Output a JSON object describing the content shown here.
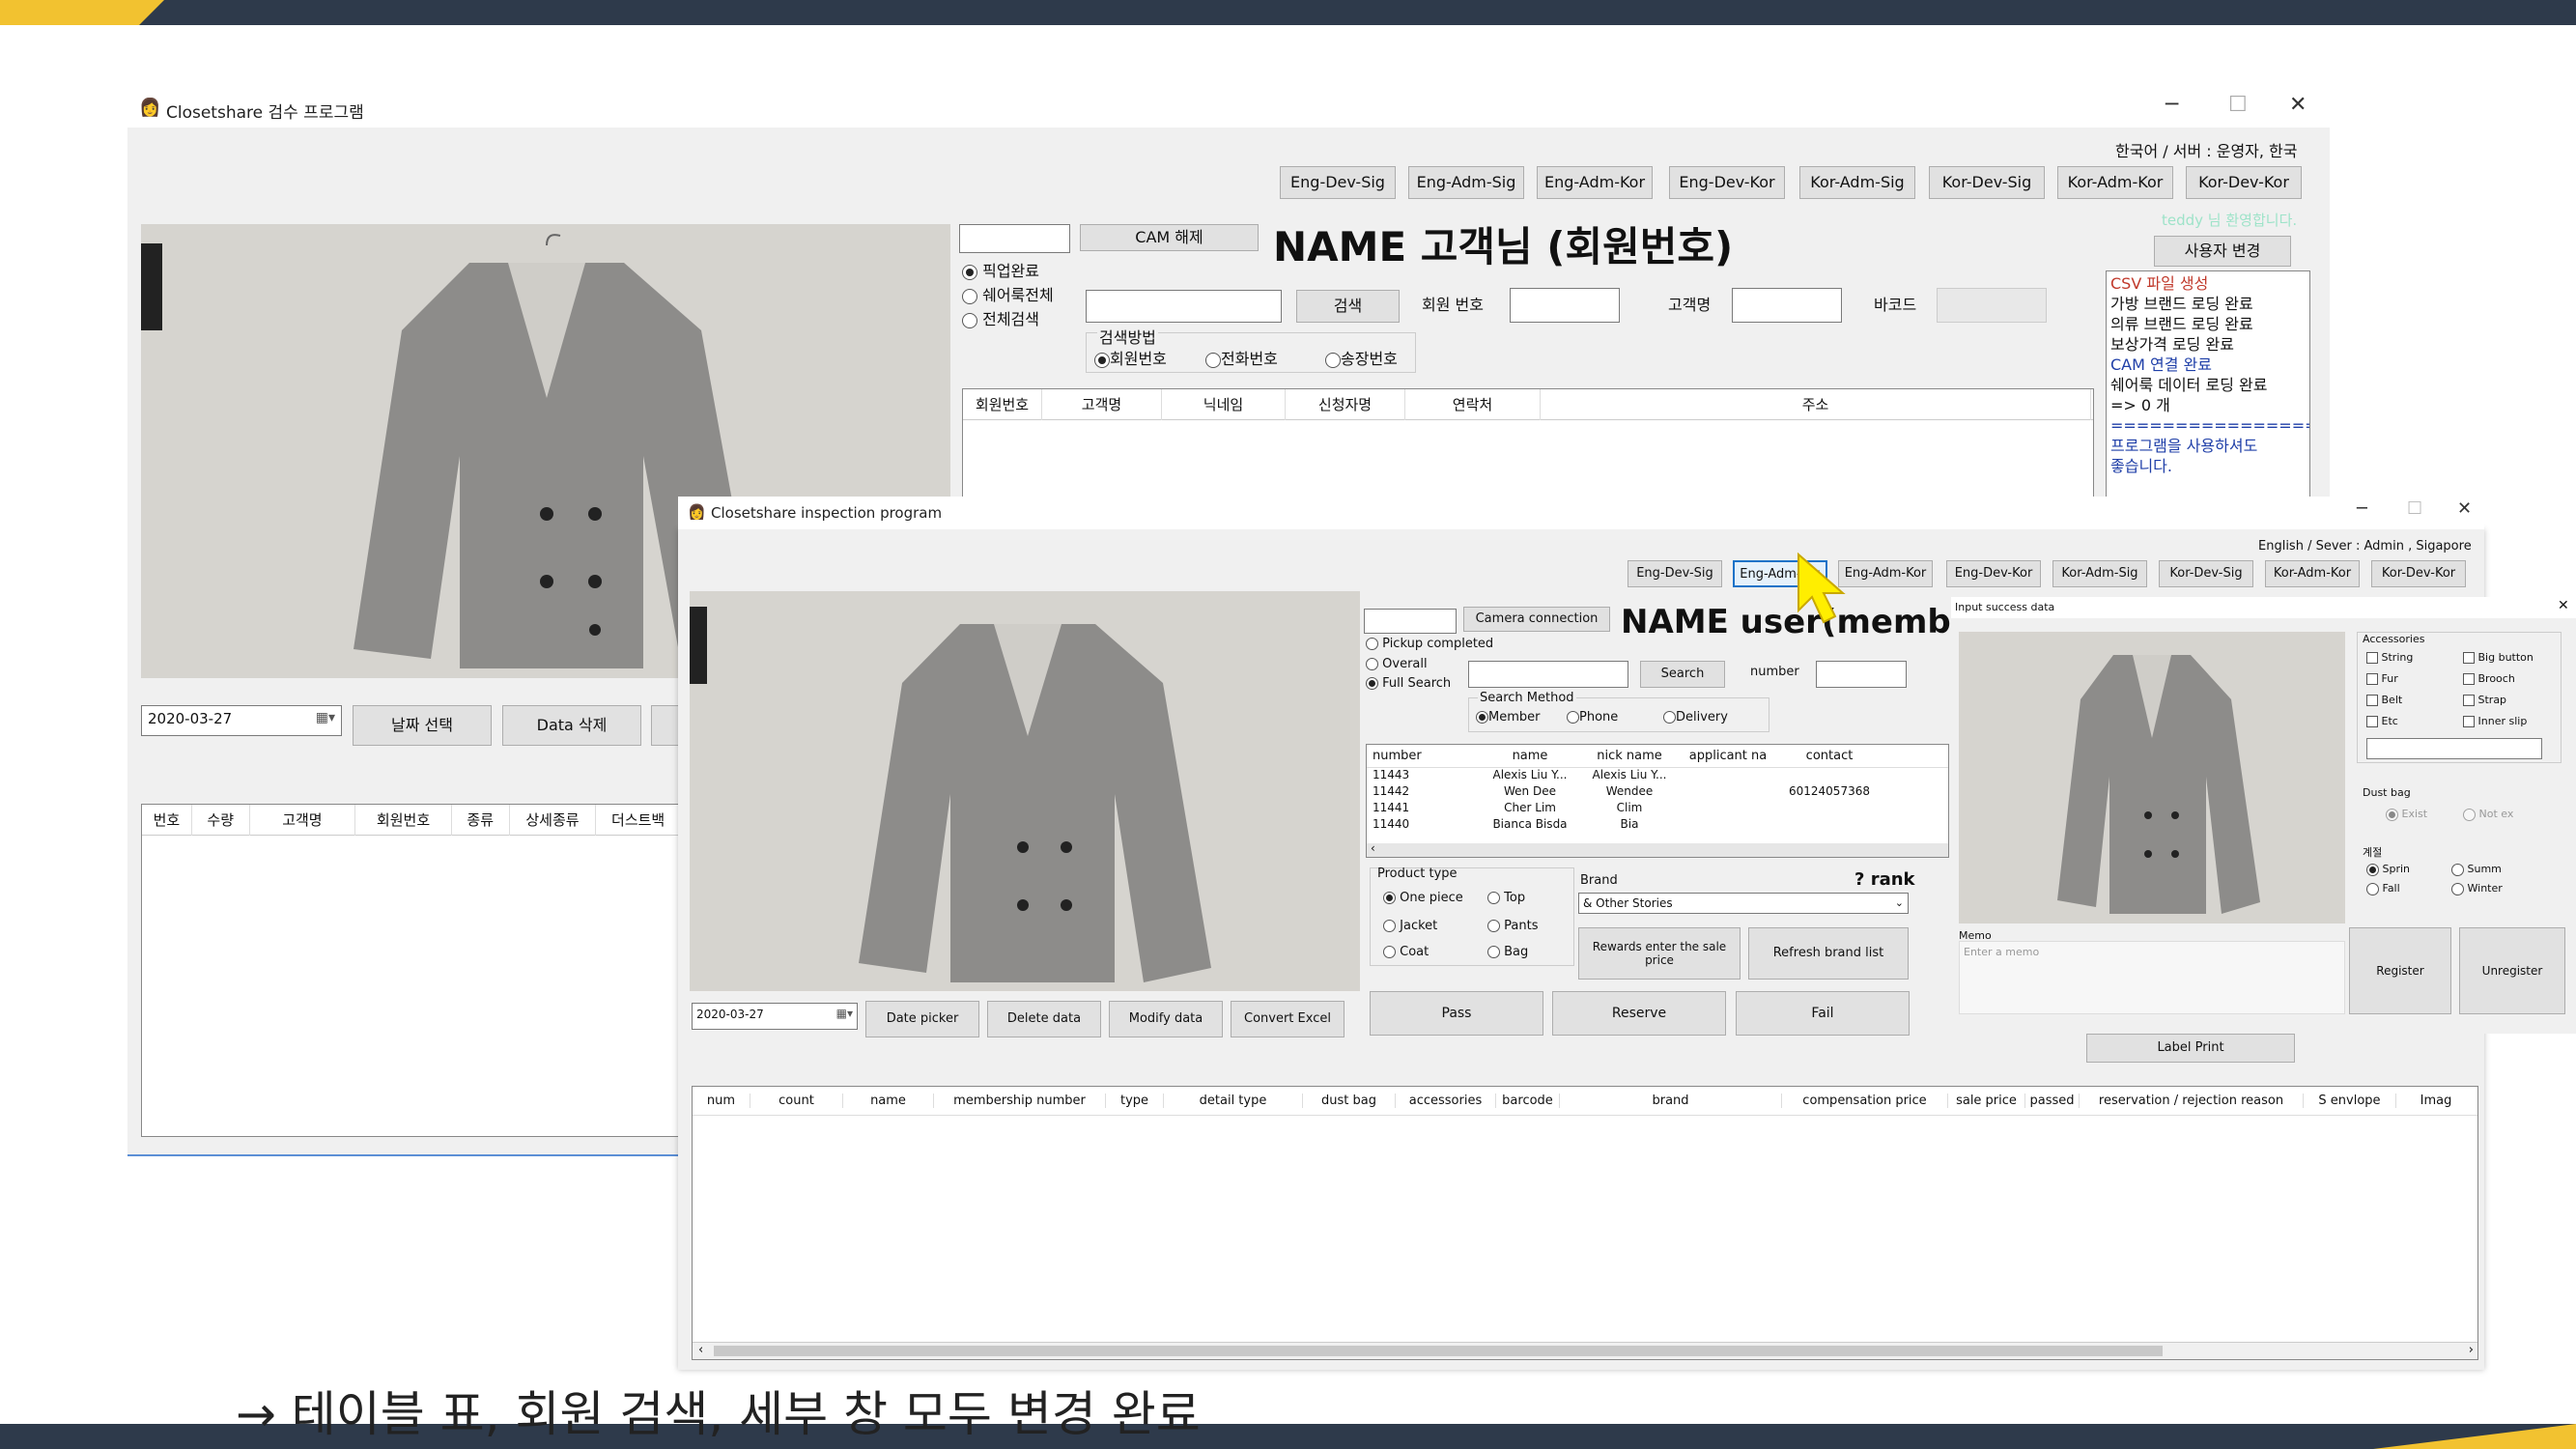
{
  "slide": {
    "caption": "→ 테이블 표, 회원 검색, 세부 창 모두 변경 완료"
  },
  "back_window": {
    "title": "Closetshare 검수 프로그램",
    "server_info": "한국어 / 서버 : 운영자, 한국",
    "welcome": "teddy 님 환영합니다.",
    "user_change": "사용자 변경",
    "env_buttons": [
      "Eng-Dev-Sig",
      "Eng-Adm-Sig",
      "Eng-Adm-Kor",
      "Eng-Dev-Kor",
      "Kor-Adm-Sig",
      "Kor-Dev-Sig",
      "Kor-Adm-Kor",
      "Kor-Dev-Kor"
    ],
    "cam_button": "CAM 해제",
    "name_title": "NAME 고객님 (회원번호)",
    "filter_radios": [
      "픽업완료",
      "쉐어룩전체",
      "전체검색"
    ],
    "search_button": "검색",
    "member_no_label": "회원 번호",
    "customer_name_label": "고객명",
    "barcode_label": "바코드",
    "search_method_label": "검색방법",
    "search_methods": [
      "회원번호",
      "전화번호",
      "송장번호"
    ],
    "customer_columns": [
      "회원번호",
      "고객명",
      "닉네임",
      "신청자명",
      "연락처",
      "주소"
    ],
    "log_lines": [
      {
        "text": "CSV 파일 생성",
        "color": "#c0392b"
      },
      {
        "text": "가방 브랜드 로딩 완료",
        "color": "#111111"
      },
      {
        "text": "의류 브랜드 로딩 완료",
        "color": "#111111"
      },
      {
        "text": "보상가격 로딩 완료",
        "color": "#111111"
      },
      {
        "text": "CAM 연결 완료",
        "color": "#1f3fa8"
      },
      {
        "text": "쉐어룩 데이터 로딩 완료",
        "color": "#111111"
      },
      {
        "text": "  => 0 개",
        "color": "#111111"
      },
      {
        "text": "==================",
        "color": "#1f3fa8"
      },
      {
        "text": "프로그램을 사용하셔도",
        "color": "#1f3fa8"
      },
      {
        "text": "좋습니다.",
        "color": "#1f3fa8"
      }
    ],
    "date_value": "2020-03-27",
    "date_button": "날짜 선택",
    "delete_button": "Data 삭제",
    "table_columns": [
      "번호",
      "수량",
      "고객명",
      "회원번호",
      "종류",
      "상세종류",
      "더스트백"
    ]
  },
  "front_window": {
    "title": "Closetshare inspection program",
    "server_info": "English / Sever : Admin , Sigapore",
    "env_buttons": [
      "Eng-Dev-Sig",
      "Eng-Adm-Sig",
      "Eng-Adm-Kor",
      "Eng-Dev-Kor",
      "Kor-Adm-Sig",
      "Kor-Dev-Sig",
      "Kor-Adm-Kor",
      "Kor-Dev-Kor"
    ],
    "camera_button": "Camera connection",
    "name_title": "NAME user(member",
    "filter_radios": [
      "Pickup completed",
      "Overall",
      "Full Search"
    ],
    "search_button": "Search",
    "number_label": "number",
    "search_method_label": "Search Method",
    "search_methods": [
      "Member",
      "Phone",
      "Delivery"
    ],
    "member_columns": [
      "number",
      "name",
      "nick name",
      "applicant na",
      "contact"
    ],
    "members": [
      {
        "number": "11443",
        "name": "Alexis Liu Y...",
        "nick": "Alexis Liu Y...",
        "applicant": "",
        "contact": ""
      },
      {
        "number": "11442",
        "name": "Wen Dee",
        "nick": "Wendee",
        "applicant": "",
        "contact": "60124057368"
      },
      {
        "number": "11441",
        "name": "Cher Lim",
        "nick": "Clim",
        "applicant": "",
        "contact": ""
      },
      {
        "number": "11440",
        "name": "Bianca Bisda",
        "nick": "Bia",
        "applicant": "",
        "contact": ""
      }
    ],
    "product_type_label": "Product type",
    "product_types": [
      "One piece",
      "Top",
      "Jacket",
      "Pants",
      "Coat",
      "Bag"
    ],
    "brand_label": "Brand",
    "brand_value": "& Other Stories",
    "rank_label": "? rank",
    "rewards_button": "Rewards enter the sale price",
    "refresh_brand_button": "Refresh brand list",
    "pass_button": "Pass",
    "reserve_button": "Reserve",
    "fail_button": "Fail",
    "label_print_button": "Label Print",
    "date_value": "2020-03-27",
    "date_picker_button": "Date picker",
    "delete_data_button": "Delete data",
    "modify_data_button": "Modify data",
    "convert_excel_button": "Convert Excel",
    "table_columns": [
      "num",
      "count",
      "name",
      "membership number",
      "type",
      "detail type",
      "dust bag",
      "accessories",
      "barcode",
      "brand",
      "compensation price",
      "sale price",
      "passed",
      "reservation / rejection reason",
      "S envlope",
      "Imag"
    ]
  },
  "detail_panel": {
    "title": "Input success data",
    "accessories_label": "Accessories",
    "accessories": [
      "String",
      "Big button",
      "Fur",
      "Brooch",
      "Belt",
      "Strap",
      "Etc",
      "Inner slip"
    ],
    "dust_bag_label": "Dust bag",
    "dust_bag_options": [
      "Exist",
      "Not ex"
    ],
    "season_label": "계절",
    "seasons": [
      "Sprin",
      "Summ",
      "Fall",
      "Winter"
    ],
    "memo_label": "Memo",
    "memo_placeholder": "Enter a memo",
    "register_button": "Register",
    "unregister_button": "Unregister"
  }
}
